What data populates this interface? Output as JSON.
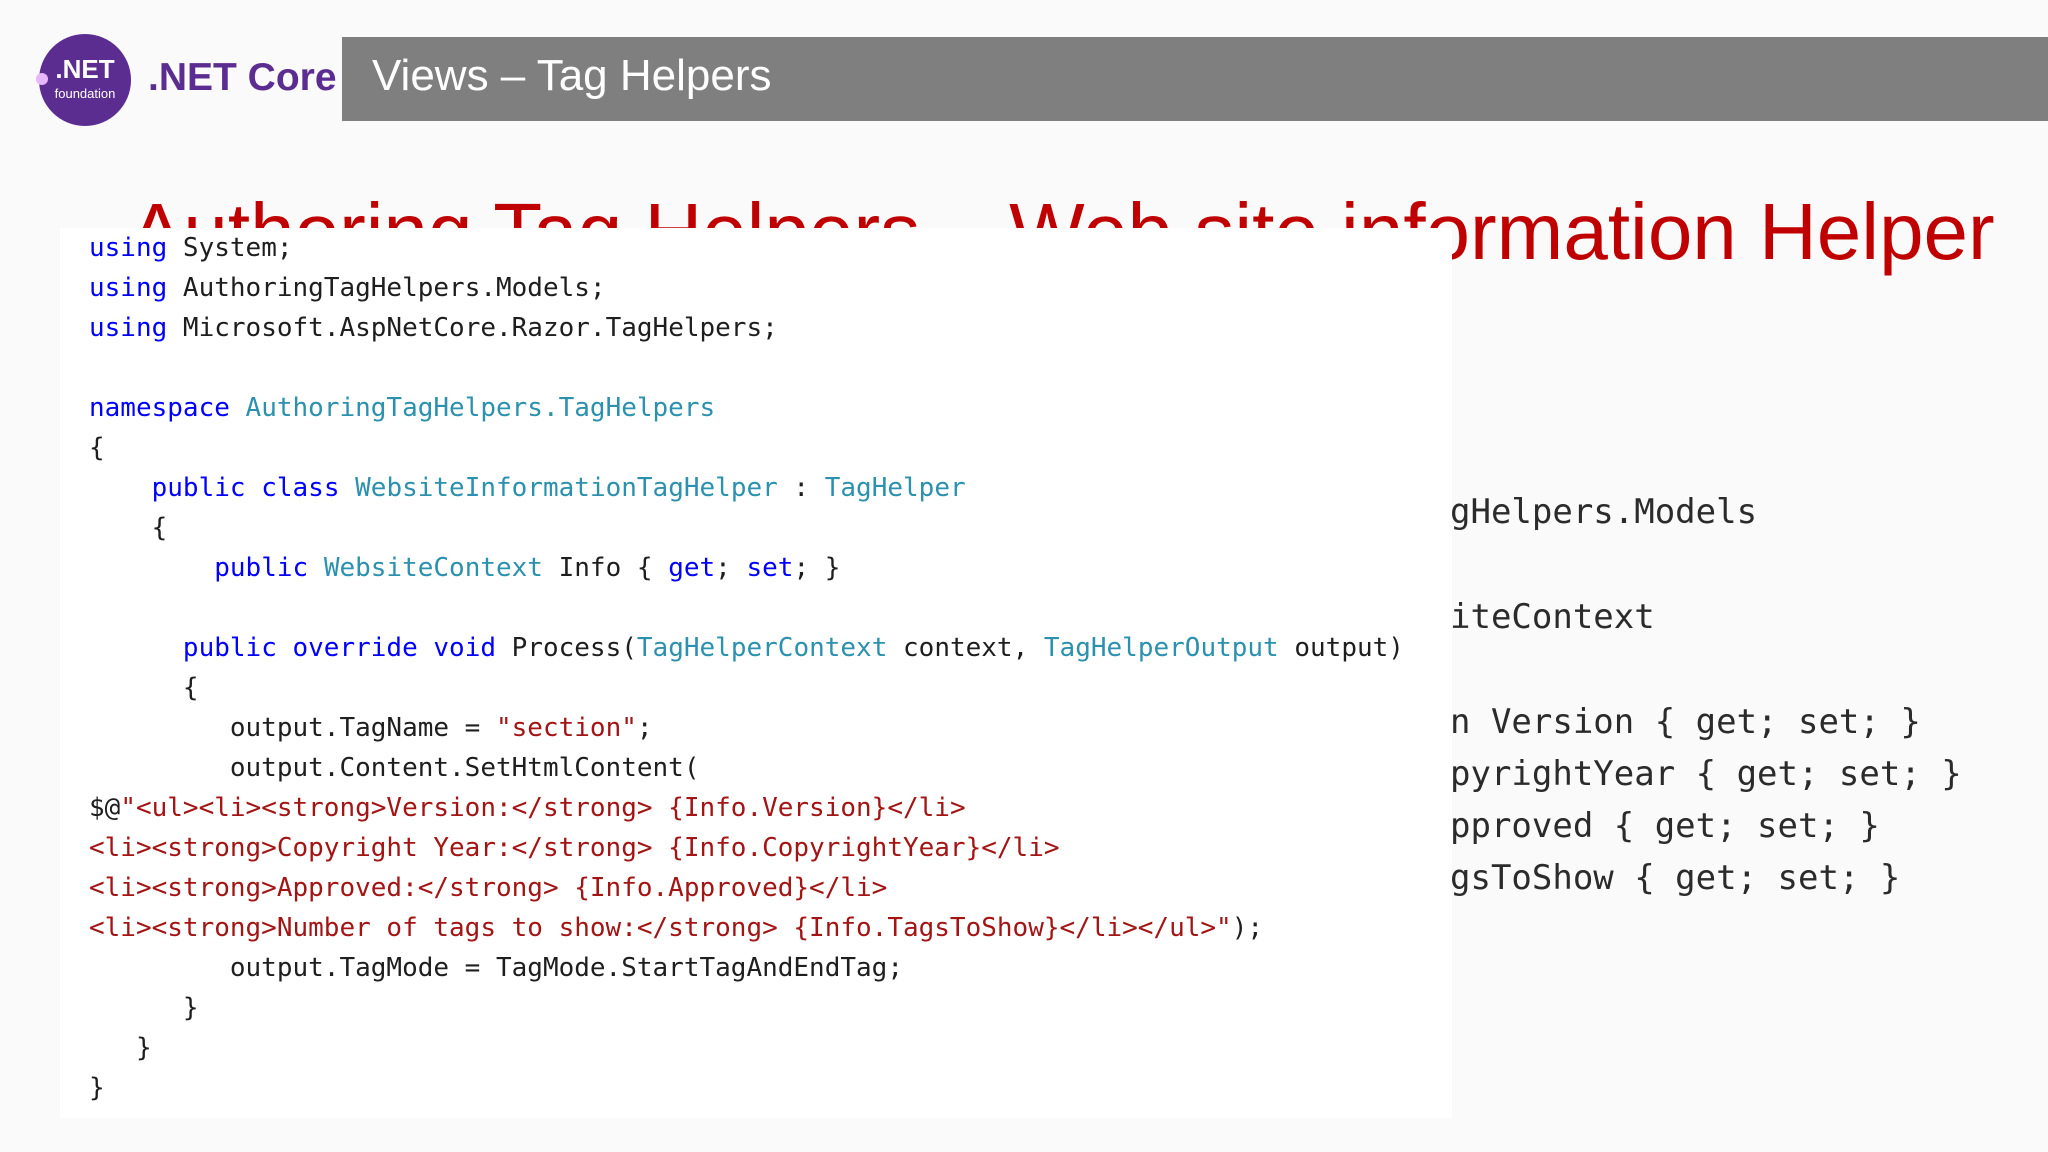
{
  "header": {
    "logo_net": ".NET",
    "logo_sub": "foundation",
    "brand": ".NET Core",
    "title": "Views – Tag Helpers"
  },
  "slide": {
    "background_heading": "Authoring Tag Helpers – Web site information Helper",
    "background_code_fragments": [
      "gHelpers.Models",
      "iteContext",
      "n Version { get; set; }",
      "pyrightYear { get; set; }",
      "pproved { get; set; }",
      "gsToShow { get; set; }"
    ]
  },
  "code": {
    "lines": [
      "using System;",
      "using AuthoringTagHelpers.Models;",
      "using Microsoft.AspNetCore.Razor.TagHelpers;",
      "",
      "namespace AuthoringTagHelpers.TagHelpers",
      "{",
      "    public class WebsiteInformationTagHelper : TagHelper",
      "    {",
      "        public WebsiteContext Info { get; set; }",
      "",
      "      public override void Process(TagHelperContext context, TagHelperOutput output)",
      "      {",
      "         output.TagName = \"section\";",
      "         output.Content.SetHtmlContent(",
      "$@\"<ul><li><strong>Version:</strong> {Info.Version}</li>",
      "<li><strong>Copyright Year:</strong> {Info.CopyrightYear}</li>",
      "<li><strong>Approved:</strong> {Info.Approved}</li>",
      "<li><strong>Number of tags to show:</strong> {Info.TagsToShow}</li></ul>\");",
      "         output.TagMode = TagMode.StartTagAndEndTag;",
      "      }",
      "   }",
      "}"
    ]
  },
  "colors": {
    "brand_purple": "#5c2d91",
    "title_bar": "#7f7f7f",
    "heading_red": "#c00000",
    "keyword": "#0000ff",
    "type": "#2b91af",
    "string": "#a31515"
  }
}
